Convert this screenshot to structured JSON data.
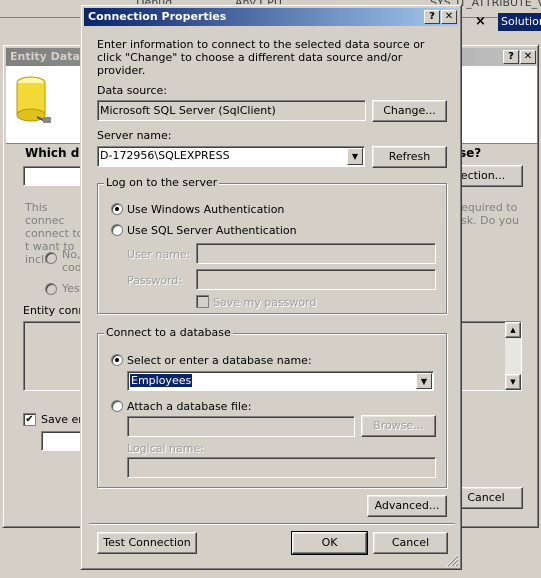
{
  "background": {
    "top_tabs": [
      "Debug",
      "Any CPU",
      "SYS_IT_ATTRIBUTE_V"
    ],
    "close_glyph": "×",
    "solution_tab": "Solution"
  },
  "wizard": {
    "title": "Entity Data M",
    "question": "Which dat",
    "question_right": "se?",
    "connection_btn": "ection...",
    "info_left": "This connec connect to t want to inclu",
    "info_right": "equired to sk. Do you",
    "radio_no": "No, code",
    "radio_yes": "Yes,",
    "entity_conn_label": "Entity conn",
    "save_label": "Save en",
    "cancel": "Cancel",
    "help_glyph": "?",
    "close_glyph": "✕"
  },
  "dialog": {
    "title": "Connection Properties",
    "help_glyph": "?",
    "close_glyph": "✕",
    "intro": "Enter information to connect to the selected data source or click \"Change\" to choose a different data source and/or provider.",
    "data_source_label": "Data source:",
    "data_source_value": "Microsoft SQL Server (SqlClient)",
    "change_btn": "Change...",
    "server_label": "Server name:",
    "server_value": "D-172956\\SQLEXPRESS",
    "refresh_btn": "Refresh",
    "logon_group": "Log on to the server",
    "windows_auth": "Use Windows Authentication",
    "sql_auth": "Use SQL Server Authentication",
    "user_label": "User name:",
    "password_label": "Password:",
    "save_password": "Save my password",
    "db_group": "Connect to a database",
    "select_db": "Select or enter a database name:",
    "db_value": "Employees",
    "attach_db": "Attach a database file:",
    "browse_btn": "Browse...",
    "logical_label": "Logical name:",
    "advanced_btn": "Advanced...",
    "test_btn": "Test Connection",
    "ok_btn": "OK",
    "cancel_btn": "Cancel"
  }
}
